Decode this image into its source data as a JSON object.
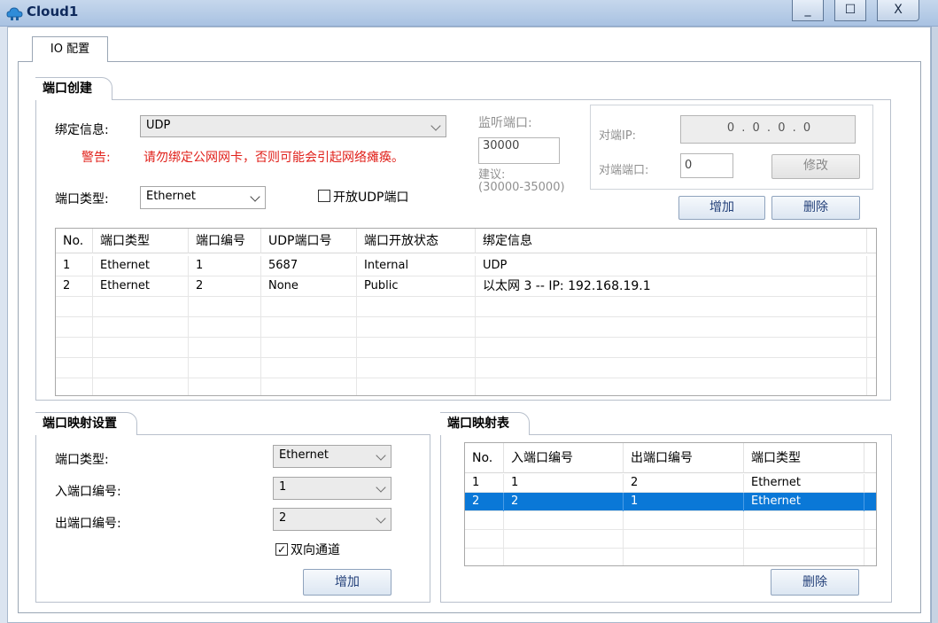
{
  "window": {
    "title": "Cloud1",
    "minimize": "_",
    "maximize": "☐",
    "close": "X"
  },
  "tab": {
    "label": "IO 配置"
  },
  "port_create": {
    "group_title": "端口创建",
    "binding_label": "绑定信息:",
    "binding_value": "UDP",
    "warning_label": "警告:",
    "warning_text": "请勿绑定公网网卡，否则可能会引起网络瘫痪。",
    "listen_port_label": "监听端口:",
    "listen_port_value": "30000",
    "suggest_label": "建议:",
    "suggest_range": "(30000-35000)",
    "peer_ip_label": "对端IP:",
    "peer_ip_value": "0 . 0 . 0 . 0",
    "peer_port_label": "对端端口:",
    "peer_port_value": "0",
    "modify_button": "修改",
    "port_type_label": "端口类型:",
    "port_type_value": "Ethernet",
    "open_udp_label": "开放UDP端口",
    "add_button": "增加",
    "delete_button": "删除",
    "table": {
      "headers": [
        "No.",
        "端口类型",
        "端口编号",
        "UDP端口号",
        "端口开放状态",
        "绑定信息"
      ],
      "rows": [
        [
          "1",
          "Ethernet",
          "1",
          "5687",
          "Internal",
          "UDP"
        ],
        [
          "2",
          "Ethernet",
          "2",
          "None",
          "Public",
          "以太网 3 -- IP: 192.168.19.1"
        ]
      ]
    }
  },
  "mapping_settings": {
    "group_title": "端口映射设置",
    "port_type_label": "端口类型:",
    "port_type_value": "Ethernet",
    "in_port_label": "入端口编号:",
    "in_port_value": "1",
    "out_port_label": "出端口编号:",
    "out_port_value": "2",
    "bidirectional_label": "双向通道",
    "bidirectional_checked": true,
    "add_button": "增加"
  },
  "mapping_table": {
    "group_title": "端口映射表",
    "headers": [
      "No.",
      "入端口编号",
      "出端口编号",
      "端口类型"
    ],
    "rows": [
      [
        "1",
        "1",
        "2",
        "Ethernet"
      ],
      [
        "2",
        "2",
        "1",
        "Ethernet"
      ]
    ],
    "selected_row": 2,
    "delete_button": "删除"
  },
  "colors": {
    "selection": "#0a78d7",
    "warning": "#e0201a",
    "title_bar": "#b7cce8"
  }
}
